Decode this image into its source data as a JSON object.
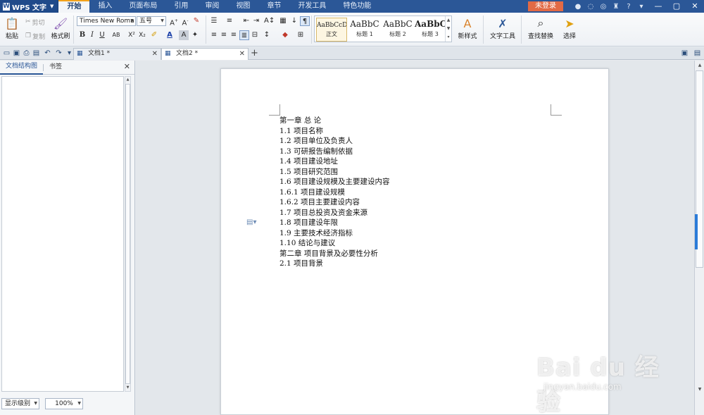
{
  "titlebar": {
    "app_name": "WPS 文字",
    "tabs": [
      "开始",
      "插入",
      "页面布局",
      "引用",
      "审阅",
      "视图",
      "章节",
      "开发工具",
      "特色功能"
    ],
    "login": "未登录",
    "help": "?"
  },
  "ribbon": {
    "paste": "粘贴",
    "cut": "剪切",
    "copy": "复制",
    "format_painter": "格式刷",
    "font_name": "Times New Roma",
    "font_size": "五号",
    "styles": [
      {
        "sample": "AaBbCcDc",
        "name": "正文"
      },
      {
        "sample": "AaBbC",
        "name": "标题 1"
      },
      {
        "sample": "AaBbC",
        "name": "标题 2"
      },
      {
        "sample": "AaBbC",
        "name": "标题 3"
      }
    ],
    "new_style": "新样式",
    "text_tools": "文字工具",
    "find_replace": "查找替换",
    "select": "选择"
  },
  "doc_tabs": [
    {
      "title": "文档1 *"
    },
    {
      "title": "文档2 *"
    }
  ],
  "nav": {
    "tab_structure": "文档结构图",
    "tab_bookmarks": "书签",
    "level_select": "显示级别",
    "zoom": "100%"
  },
  "document": {
    "lines": [
      "第一章   总  论",
      "1.1  项目名称",
      "1.2  项目单位及负责人",
      "1.3  可研报告编制依据",
      "1.4  项目建设地址",
      "1.5  项目研究范围",
      "1.6  项目建设规模及主要建设内容",
      "1.6.1  项目建设规模",
      "1.6.2  项目主要建设内容",
      "1.7  项目总投资及资金来源",
      "1.8  项目建设年限",
      "1.9  主要技术经济指标",
      "1.10  结论与建议",
      "第二章    项目背景及必要性分析",
      "2.1  项目背景"
    ]
  },
  "watermark": {
    "main": "Bai du 经验",
    "sub": "jingyan.baidu.com"
  }
}
